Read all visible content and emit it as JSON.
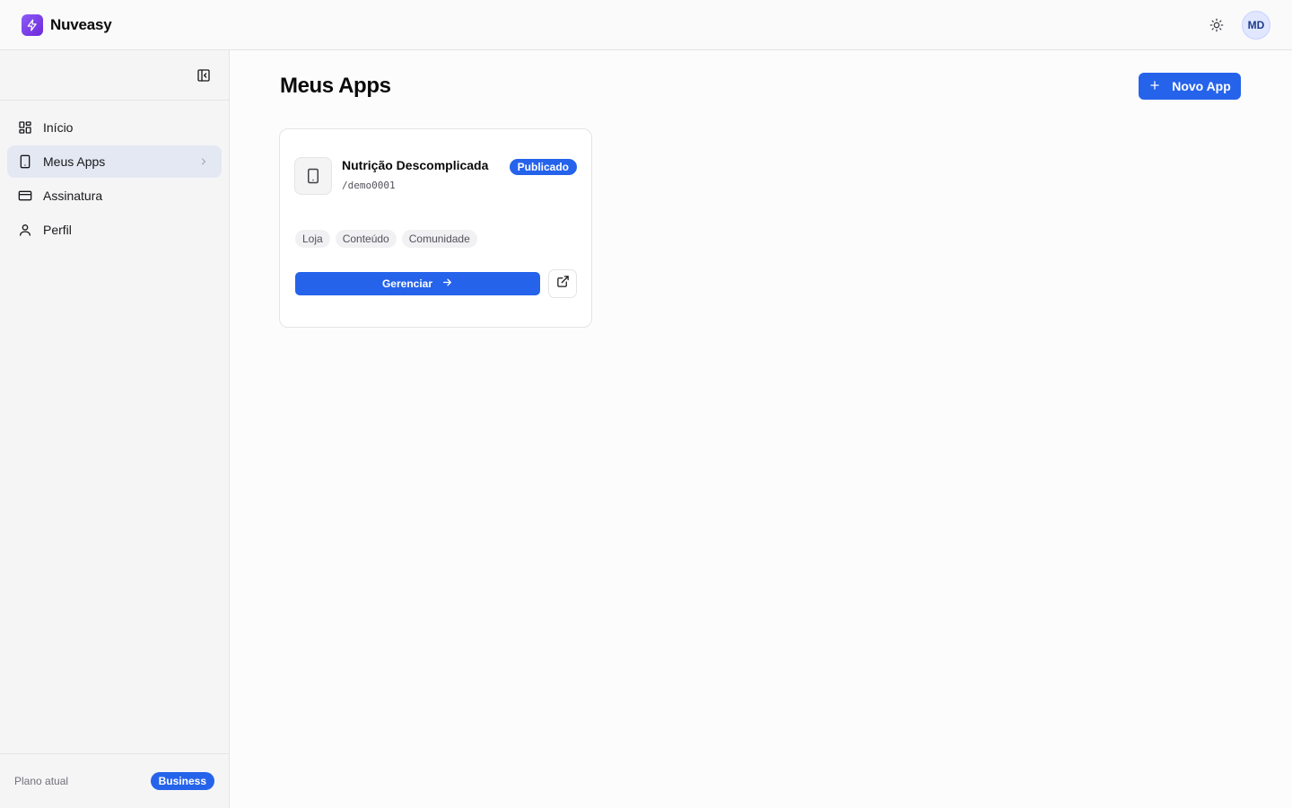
{
  "app": {
    "name": "Nuveasy"
  },
  "header": {
    "user_initials": "MD"
  },
  "sidebar": {
    "items": [
      {
        "label": "Início",
        "icon": "dashboard-grid-icon"
      },
      {
        "label": "Meus Apps",
        "icon": "phone-icon",
        "active": true
      },
      {
        "label": "Assinatura",
        "icon": "credit-card-icon"
      },
      {
        "label": "Perfil",
        "icon": "user-icon"
      }
    ],
    "footer": {
      "plan_label": "Plano atual",
      "plan_name": "Business"
    }
  },
  "main": {
    "title": "Meus Apps",
    "new_button_label": "Novo App",
    "apps": [
      {
        "name": "Nutrição Descomplicada",
        "slug": "/demo0001",
        "status": "Publicado",
        "tags": [
          "Loja",
          "Conteúdo",
          "Comunidade"
        ],
        "manage_label": "Gerenciar"
      }
    ]
  },
  "colors": {
    "accent": "#2563eb",
    "brand": "#7c3aed"
  }
}
